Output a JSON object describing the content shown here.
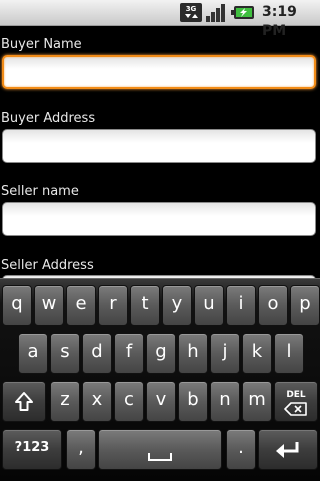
{
  "status_bar": {
    "network_type": "3G",
    "time": "3:19 PM",
    "icons": [
      "3g-network-icon",
      "signal-strength-icon",
      "battery-charging-icon"
    ]
  },
  "form": {
    "fields": [
      {
        "label": "Buyer Name",
        "value": "",
        "focused": true
      },
      {
        "label": "Buyer Address",
        "value": ""
      },
      {
        "label": "Seller name",
        "value": ""
      },
      {
        "label": "Seller Address",
        "value": ""
      }
    ]
  },
  "keyboard": {
    "row1": [
      "q",
      "w",
      "e",
      "r",
      "t",
      "y",
      "u",
      "i",
      "o",
      "p"
    ],
    "row2": [
      "a",
      "s",
      "d",
      "f",
      "g",
      "h",
      "j",
      "k",
      "l"
    ],
    "row3": [
      "z",
      "x",
      "c",
      "v",
      "b",
      "n",
      "m"
    ],
    "shift_icon": "shift-icon",
    "delete_label": "DEL",
    "symbols_label": "?123",
    "comma_label": ",",
    "period_label": ".",
    "space_icon": "space-bar-icon",
    "enter_icon": "enter-arrow-icon"
  },
  "colors": {
    "focus_accent": "#f28c18",
    "background": "#000000",
    "key_face": "#5a5a5a"
  }
}
